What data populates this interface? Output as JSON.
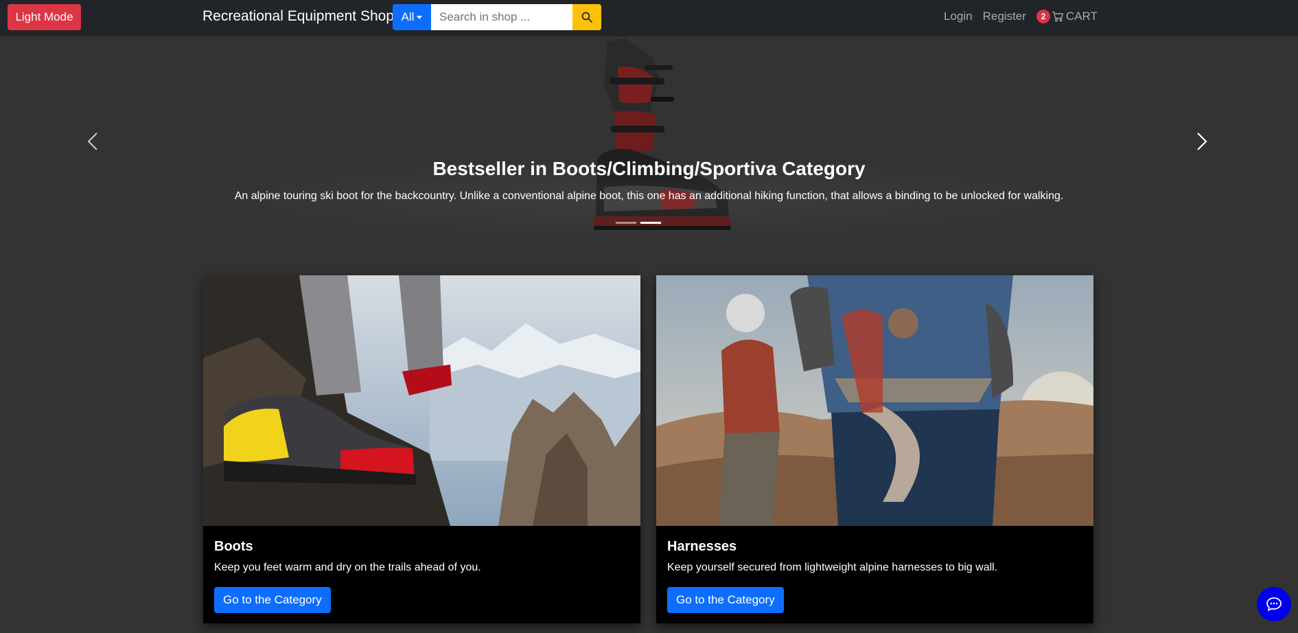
{
  "header": {
    "mode_button": "Light Mode",
    "brand": "Recreational Equipment Shop",
    "search": {
      "category": "All",
      "placeholder": "Search in shop ...",
      "button_icon": "search-icon"
    },
    "links": {
      "login": "Login",
      "register": "Register"
    },
    "cart": {
      "count": "2",
      "label": "CART",
      "icon": "cart-icon"
    }
  },
  "carousel": {
    "title": "Bestseller in Boots/Climbing/Sportiva Category",
    "text": "An alpine touring ski boot for the backcountry. Unlike a conventional alpine boot, this one has an additional hiking function, that allows a binding to be unlocked for walking.",
    "indicator_count": 2,
    "active_indicator": 2,
    "prev_icon": "chevron-left-icon",
    "next_icon": "chevron-right-icon"
  },
  "cards": [
    {
      "title": "Boots",
      "text": "Keep you feet warm and dry on the trails ahead of you.",
      "button": "Go to the Category"
    },
    {
      "title": "Harnesses",
      "text": "Keep yourself secured from lightweight alpine harnesses to big wall.",
      "button": "Go to the Category"
    }
  ],
  "chat_icon": "chat-bubble-icon",
  "colors": {
    "background": "#333333",
    "navbar": "#212529",
    "danger": "#dc3545",
    "primary": "#0d6efd",
    "warning": "#ffc107",
    "card": "#000000",
    "chat": "#0000ee"
  }
}
